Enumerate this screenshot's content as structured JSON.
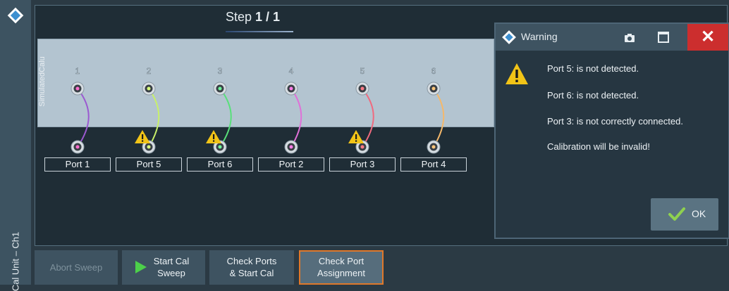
{
  "sidebar": {
    "label": "Cal Unit – Ch1"
  },
  "wizard": {
    "step_label": "Step",
    "step_value": "1 / 1"
  },
  "cal_unit": {
    "name": "SimulatedCalu",
    "ports": [
      {
        "number": "1",
        "cable_color": "#9b59d0",
        "connector_dot": "#ff6fcf"
      },
      {
        "number": "2",
        "cable_color": "#c8f06a",
        "connector_dot": "#d8ff7a"
      },
      {
        "number": "3",
        "cable_color": "#58e07a",
        "connector_dot": "#6ef59a"
      },
      {
        "number": "4",
        "cable_color": "#e070d8",
        "connector_dot": "#ff7de8"
      },
      {
        "number": "5",
        "cable_color": "#f06a7e",
        "connector_dot": "#ff7a86"
      },
      {
        "number": "6",
        "cable_color": "#f5b86a",
        "connector_dot": "#ffc67a"
      }
    ]
  },
  "vna_ports": [
    {
      "label": "Port 1",
      "warning": false
    },
    {
      "label": "Port 5",
      "warning": true
    },
    {
      "label": "Port 6",
      "warning": true
    },
    {
      "label": "Port 2",
      "warning": false
    },
    {
      "label": "Port 3",
      "warning": true
    },
    {
      "label": "Port 4",
      "warning": false
    }
  ],
  "dialog": {
    "title": "Warning",
    "messages": [
      "Port 5: is not detected.",
      "Port 6: is not detected.",
      "Port 3: is not correctly connected.",
      "Calibration will be invalid!"
    ],
    "ok_label": "OK"
  },
  "toolbar": {
    "abort_sweep": "Abort Sweep",
    "start_cal_sweep_1": "Start Cal",
    "start_cal_sweep_2": "Sweep",
    "check_ports_1": "Check Ports",
    "check_ports_2": "& Start Cal",
    "check_assignment_1": "Check Port",
    "check_assignment_2": "Assignment"
  },
  "colors": {
    "close_red": "#cc2e2e",
    "active_border": "#e0782a",
    "warning_yellow": "#f2c417",
    "play_green": "#4cd04a",
    "check_green": "#8fd14f"
  }
}
